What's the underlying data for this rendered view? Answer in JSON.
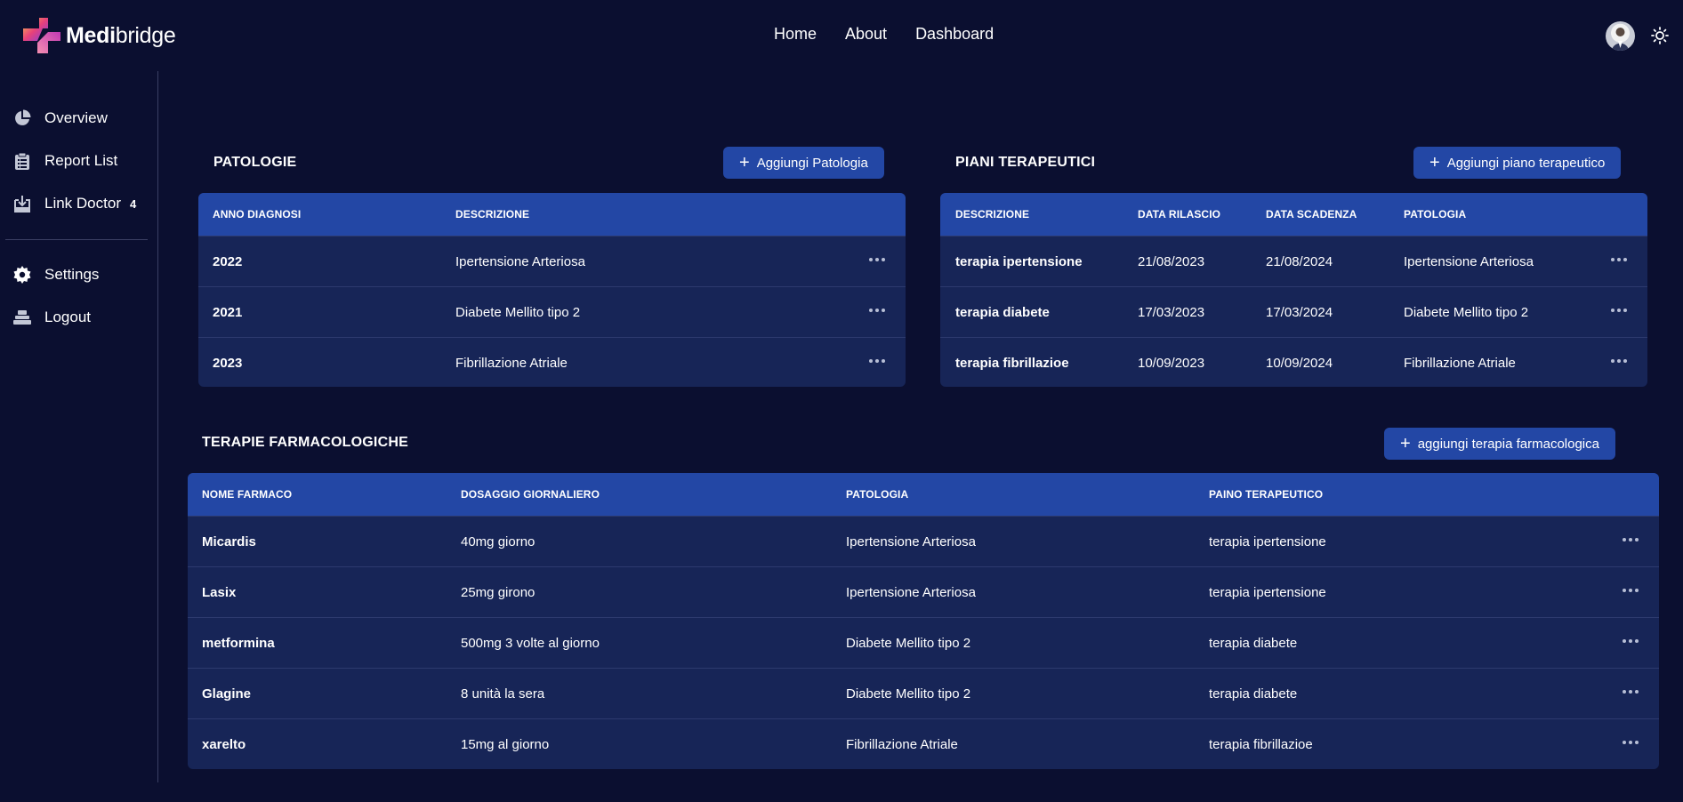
{
  "header": {
    "logo_bold": "Medi",
    "logo_light": "bridge",
    "nav": [
      "Home",
      "About",
      "Dashboard"
    ]
  },
  "sidebar": {
    "items": [
      {
        "label": "Overview",
        "icon": "pie-chart-icon"
      },
      {
        "label": "Report List",
        "icon": "clipboard-icon"
      },
      {
        "label": "Link Doctor",
        "icon": "inbox-download-icon",
        "badge": "4"
      },
      {
        "label": "Settings",
        "icon": "gear-icon"
      },
      {
        "label": "Logout",
        "icon": "logout-icon"
      }
    ]
  },
  "patologie": {
    "title": "PATOLOGIE",
    "button": "Aggiungi Patologia",
    "columns": [
      "ANNO DIAGNOSI",
      "DESCRIZIONE"
    ],
    "rows": [
      [
        "2022",
        "Ipertensione Arteriosa"
      ],
      [
        "2021",
        "Diabete Mellito tipo 2"
      ],
      [
        "2023",
        "Fibrillazione Atriale"
      ]
    ]
  },
  "piani": {
    "title": "PIANI TERAPEUTICI",
    "button": "Aggiungi piano terapeutico",
    "columns": [
      "DESCRIZIONE",
      "DATA RILASCIO",
      "DATA SCADENZA",
      "PATOLOGIA"
    ],
    "rows": [
      [
        "terapia ipertensione",
        "21/08/2023",
        "21/08/2024",
        "Ipertensione Arteriosa"
      ],
      [
        "terapia diabete",
        "17/03/2023",
        "17/03/2024",
        "Diabete Mellito tipo 2"
      ],
      [
        "terapia fibrillazioe",
        "10/09/2023",
        "10/09/2024",
        "Fibrillazione Atriale"
      ]
    ]
  },
  "terapie": {
    "title": "TERAPIE FARMACOLOGICHE",
    "button": "aggiungi terapia farmacologica",
    "columns": [
      "NOME FARMACO",
      "DOSAGGIO GIORNALIERO",
      "PATOLOGIA",
      "PAINO TERAPEUTICO"
    ],
    "rows": [
      [
        "Micardis",
        "40mg giorno",
        "Ipertensione Arteriosa",
        "terapia ipertensione"
      ],
      [
        "Lasix",
        "25mg girono",
        "Ipertensione Arteriosa",
        "terapia ipertensione"
      ],
      [
        "metformina",
        "500mg 3 volte al giorno",
        "Diabete Mellito tipo 2",
        "terapia diabete"
      ],
      [
        "Glagine",
        "8 unità la sera",
        "Diabete Mellito tipo 2",
        "terapia diabete"
      ],
      [
        "xarelto",
        "15mg al giorno",
        "Fibrillazione Atriale",
        "terapia fibrillazioe"
      ]
    ]
  },
  "colors": {
    "background": "#0b0f30",
    "table_body": "#172557",
    "table_header": "#2347a5",
    "button": "#2347a5"
  }
}
